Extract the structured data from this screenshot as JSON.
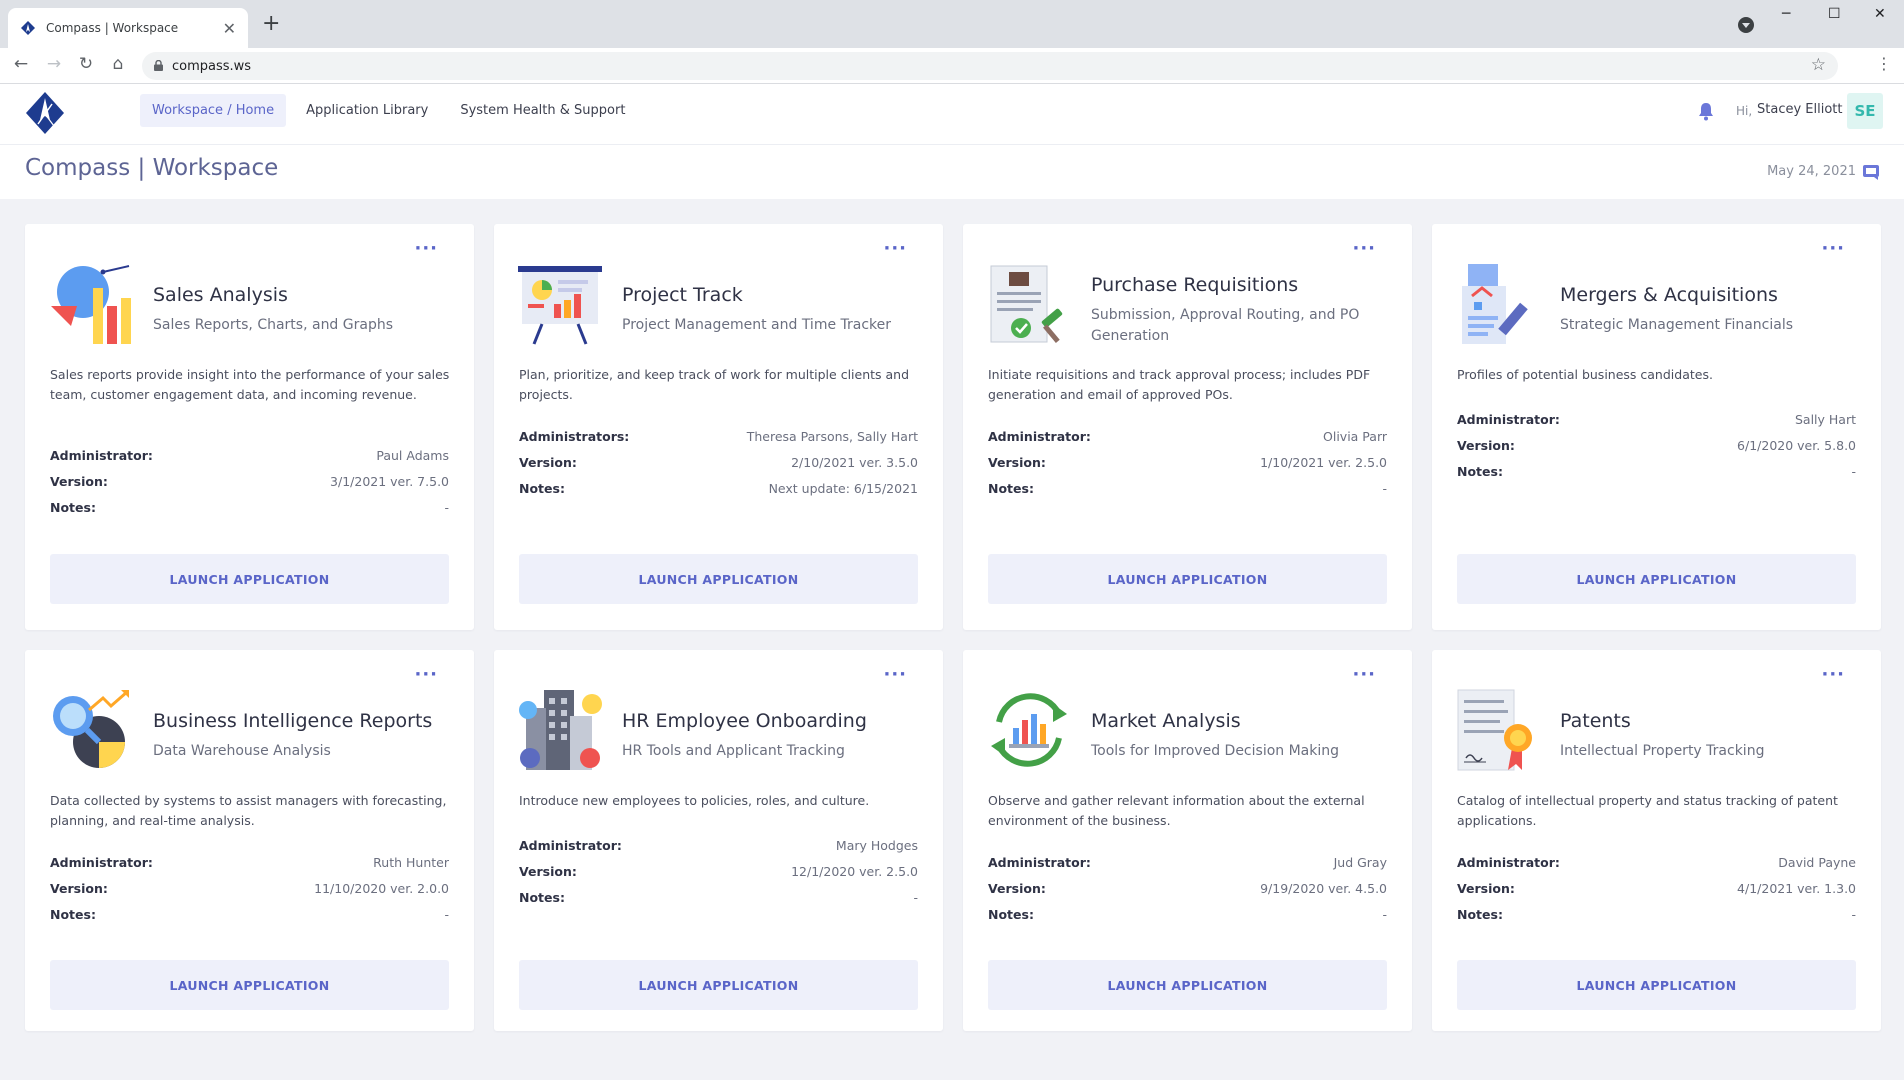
{
  "browser": {
    "tab_title": "Compass | Workspace",
    "tab_close": "✕",
    "new_tab": "+",
    "url": "compass.ws",
    "minimize": "─",
    "maximize": "☐",
    "close": "✕",
    "back": "←",
    "forward": "→",
    "reload": "↻",
    "home": "⌂",
    "star": "☆",
    "menu": "⋮"
  },
  "header": {
    "nav": [
      {
        "label": "Workspace / Home",
        "active": true
      },
      {
        "label": "Application Library",
        "active": false
      },
      {
        "label": "System Health & Support",
        "active": false
      }
    ],
    "greeting": "Hi,",
    "user_name": "Stacey Elliott",
    "avatar_initials": "SE"
  },
  "page": {
    "title": "Compass | Workspace",
    "date": "May 24, 2021"
  },
  "labels": {
    "launch": "LAUNCH APPLICATION",
    "administrator": "Administrator:",
    "administrators": "Administrators:",
    "version": "Version:",
    "notes": "Notes:",
    "dots": "···"
  },
  "cards": [
    {
      "title": "Sales Analysis",
      "subtitle": "Sales Reports, Charts, and Graphs",
      "description": "Sales reports provide insight into the performance of your sales team, customer engagement data, and incoming revenue.",
      "admin_label": "Administrator:",
      "administrator": "Paul Adams",
      "version": "3/1/2021 ver. 7.5.0",
      "notes": "-",
      "icon": "sales-chart-icon"
    },
    {
      "title": "Project Track",
      "subtitle": "Project Management and Time Tracker",
      "description": "Plan, prioritize, and keep track of work for multiple clients and projects.",
      "admin_label": "Administrators:",
      "administrator": "Theresa Parsons, Sally Hart",
      "version": "2/10/2021 ver. 3.5.0",
      "notes": "Next update: 6/15/2021",
      "icon": "presentation-board-icon"
    },
    {
      "title": "Purchase Requisitions",
      "subtitle": "Submission, Approval Routing, and PO Generation",
      "description": "Initiate requisitions and track approval process; includes PDF generation and email of approved POs.",
      "admin_label": "Administrator:",
      "administrator": "Olivia Parr",
      "version": "1/10/2021 ver. 2.5.0",
      "notes": "-",
      "icon": "approved-document-icon"
    },
    {
      "title": "Mergers & Acquisitions",
      "subtitle": "Strategic Management Financials",
      "description": "Profiles of potential business candidates.",
      "admin_label": "Administrator:",
      "administrator": "Sally Hart",
      "version": "6/1/2020 ver. 5.8.0",
      "notes": "-",
      "icon": "building-contract-icon"
    },
    {
      "title": "Business Intelligence Reports",
      "subtitle": "Data Warehouse Analysis",
      "description": "Data collected by systems to assist managers with forecasting, planning, and real-time analysis.",
      "admin_label": "Administrator:",
      "administrator": "Ruth Hunter",
      "version": "11/10/2020 ver. 2.0.0",
      "notes": "-",
      "icon": "magnifier-pie-icon"
    },
    {
      "title": "HR Employee Onboarding",
      "subtitle": "HR Tools and Applicant Tracking",
      "description": "Introduce new employees to policies, roles, and culture.",
      "admin_label": "Administrator:",
      "administrator": "Mary Hodges",
      "version": "12/1/2020 ver. 2.5.0",
      "notes": "-",
      "icon": "office-people-icon"
    },
    {
      "title": "Market Analysis",
      "subtitle": "Tools for Improved Decision Making",
      "description": "Observe and gather relevant information about the external environment of the business.",
      "admin_label": "Administrator:",
      "administrator": "Jud Gray",
      "version": "9/19/2020 ver. 4.5.0",
      "notes": "-",
      "icon": "cycle-chart-icon"
    },
    {
      "title": "Patents",
      "subtitle": "Intellectual Property Tracking",
      "description": "Catalog of intellectual property and status tracking of patent applications.",
      "admin_label": "Administrator:",
      "administrator": "David Payne",
      "version": "4/1/2021 ver. 1.3.0",
      "notes": "-",
      "icon": "certificate-icon"
    }
  ]
}
